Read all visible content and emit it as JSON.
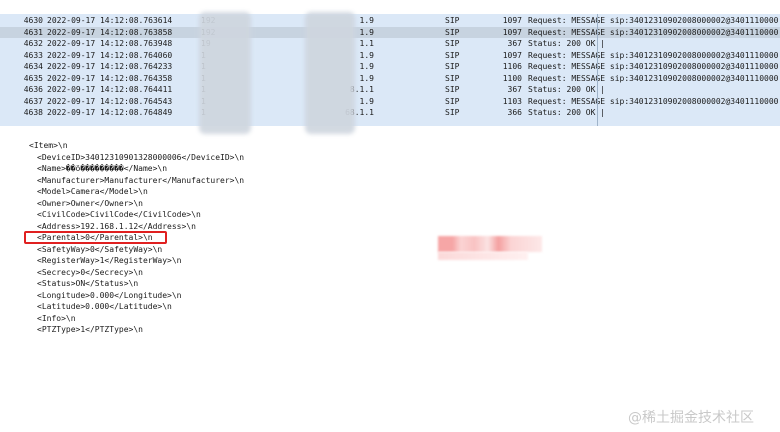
{
  "packets": [
    {
      "no": "4630",
      "time": "2022-09-17 14:12:08.763614",
      "src": "192",
      "dst": "1.9",
      "proto": "SIP",
      "len": "1097",
      "info": "Request: MESSAGE sip:34012310902008000002@3401110000.sp"
    },
    {
      "no": "4631",
      "time": "2022-09-17 14:12:08.763858",
      "src": "192",
      "dst": "1.9",
      "proto": "SIP",
      "len": "1097",
      "info": "Request: MESSAGE sip:34012310902008000002@3401110000.sp",
      "selected": true
    },
    {
      "no": "4632",
      "time": "2022-09-17 14:12:08.763948",
      "src": "19",
      "dst": "1.1",
      "proto": "SIP",
      "len": "367",
      "info": "Status: 200 OK |"
    },
    {
      "no": "4633",
      "time": "2022-09-17 14:12:08.764060",
      "src": "1",
      "dst": "1.9",
      "proto": "SIP",
      "len": "1097",
      "info": "Request: MESSAGE sip:34012310902008000002@3401110000.sp"
    },
    {
      "no": "4634",
      "time": "2022-09-17 14:12:08.764233",
      "src": "1",
      "dst": "1.9",
      "proto": "SIP",
      "len": "1106",
      "info": "Request: MESSAGE sip:34012310902008000002@3401110000.sp"
    },
    {
      "no": "4635",
      "time": "2022-09-17 14:12:08.764358",
      "src": "1",
      "dst": "1.9",
      "proto": "SIP",
      "len": "1100",
      "info": "Request: MESSAGE sip:34012310902008000002@3401110000.sp"
    },
    {
      "no": "4636",
      "time": "2022-09-17 14:12:08.764411",
      "src": "1",
      "dst": "8.1.1",
      "proto": "SIP",
      "len": "367",
      "info": "Status: 200 OK |"
    },
    {
      "no": "4637",
      "time": "2022-09-17 14:12:08.764543",
      "src": "1",
      "dst": "1.9",
      "proto": "SIP",
      "len": "1103",
      "info": "Request: MESSAGE sip:34012310902008000002@3401110000.sp"
    },
    {
      "no": "4638",
      "time": "2022-09-17 14:12:08.764849",
      "src": "1",
      "dst": "68.1.1",
      "proto": "SIP",
      "len": "366",
      "info": "Status: 200 OK |"
    }
  ],
  "xml_lines": [
    "<Item>\\n",
    "<DeviceID>34012310901328000006</DeviceID>\\n",
    "<Name>��ö���������</Name>\\n",
    "<Manufacturer>Manufacturer</Manufacturer>\\n",
    "<Model>Camera</Model>\\n",
    "<Owner>Owner</Owner>\\n",
    "<CivilCode>CivilCode</CivilCode>\\n",
    "<Address>192.168.1.12</Address>\\n",
    "<Parental>0</Parental>\\n",
    "<SafetyWay>0</SafetyWay>\\n",
    "<RegisterWay>1</RegisterWay>\\n",
    "<Secrecy>0</Secrecy>\\n",
    "<Status>ON</Status>\\n",
    "<Longitude>0.000</Longitude>\\n",
    "<Latitude>0.000</Latitude>\\n",
    "<Info>\\n",
    "<PTZType>1</PTZType>\\n"
  ],
  "watermark": "@稀土掘金技术社区",
  "colors": {
    "list_bg": "#dbe8f7",
    "selected_bg": "#c7d3e0",
    "highlight": "#e02020",
    "redact": "#f4a3a3"
  }
}
